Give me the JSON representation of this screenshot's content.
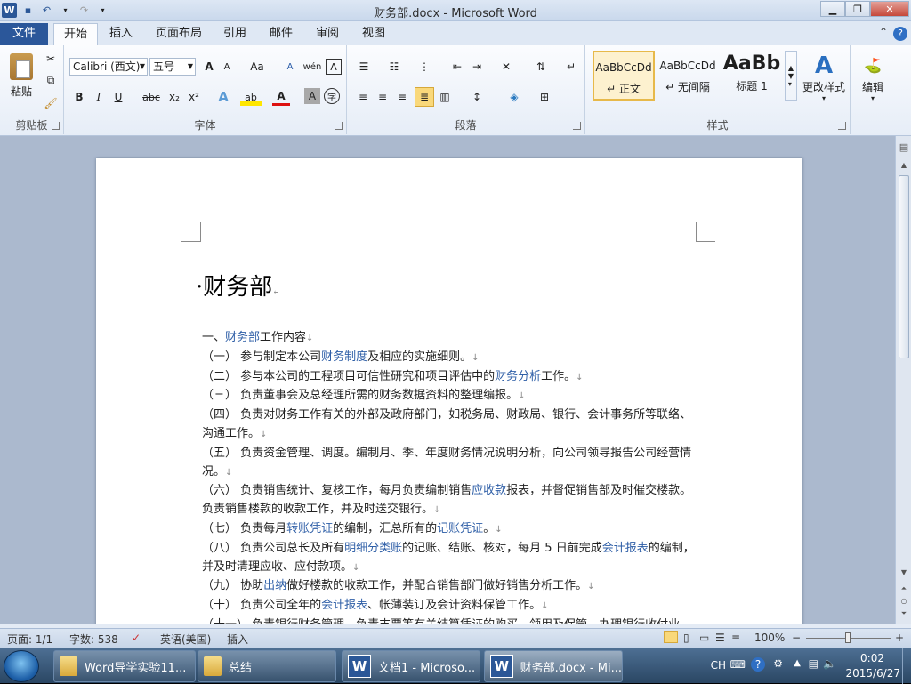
{
  "window": {
    "title": "财务部.docx - Microsoft Word",
    "min": "▁",
    "max": "❐",
    "close": "✕"
  },
  "qat": {
    "logo": "W",
    "save": "💾",
    "undo": "↶",
    "redo": "↷",
    "more": "▾"
  },
  "tabs": [
    {
      "label": "文件"
    },
    {
      "label": "开始"
    },
    {
      "label": "插入"
    },
    {
      "label": "页面布局"
    },
    {
      "label": "引用"
    },
    {
      "label": "邮件"
    },
    {
      "label": "审阅"
    },
    {
      "label": "视图"
    }
  ],
  "ribbon": {
    "clipboard": {
      "label": "剪贴板",
      "paste": "粘贴"
    },
    "font": {
      "label": "字体",
      "name": "Calibri (西文)",
      "size": "五号",
      "grow": "A",
      "shrink": "A",
      "case": "Aa",
      "bold": "B",
      "italic": "I",
      "underline": "U",
      "strike": "abc",
      "sub": "x₂",
      "sup": "x²",
      "effects": "A",
      "highlight": "ab",
      "color": "A",
      "shading": "A",
      "circle": "字",
      "clear": "A",
      "wen": "文",
      "phon": "wén",
      "border": "A"
    },
    "paragraph": {
      "label": "段落"
    },
    "styles": {
      "label": "样式",
      "items": [
        {
          "preview": "AaBbCcDd",
          "name": "↵ 正文"
        },
        {
          "preview": "AaBbCcDd",
          "name": "↵ 无间隔"
        },
        {
          "preview": "AaBb",
          "name": "标题 1"
        }
      ],
      "change": "更改样式"
    },
    "edit": {
      "label": "编辑"
    }
  },
  "document": {
    "title": "财务部",
    "paragraphs": [
      [
        {
          "t": "一、"
        },
        {
          "t": "财务部",
          "l": 1
        },
        {
          "t": "工作内容"
        }
      ],
      [
        {
          "t": "（一）  参与制定本公司"
        },
        {
          "t": "财务制度",
          "l": 1
        },
        {
          "t": "及相应的实施细则。"
        }
      ],
      [
        {
          "t": "（二）  参与本公司的工程项目可信性研究和项目评估中的"
        },
        {
          "t": "财务分析",
          "l": 1
        },
        {
          "t": "工作。"
        }
      ],
      [
        {
          "t": "（三）  负责董事会及总经理所需的财务数据资料的整理编报。"
        }
      ],
      [
        {
          "t": "（四）  负责对财务工作有关的外部及政府部门，如税务局、财政局、银行、会计事务所等联络、沟通工作。"
        }
      ],
      [
        {
          "t": "（五）  负责资金管理、调度。编制月、季、年度财务情况说明分析，向公司领导报告公司经营情况。"
        }
      ],
      [
        {
          "t": "（六）  负责销售统计、复核工作，每月负责编制销售"
        },
        {
          "t": "应收款",
          "l": 1
        },
        {
          "t": "报表，并督促销售部及时催交楼款。负责销售楼款的收款工作，并及时送交银行。"
        }
      ],
      [
        {
          "t": "（七）  负责每月"
        },
        {
          "t": "转账凭证",
          "l": 1
        },
        {
          "t": "的编制，汇总所有的"
        },
        {
          "t": "记账凭证",
          "l": 1
        },
        {
          "t": "。"
        }
      ],
      [
        {
          "t": "（八）  负责公司总长及所有"
        },
        {
          "t": "明细分类账",
          "l": 1
        },
        {
          "t": "的记账、结账、核对，每月 5 日前完成"
        },
        {
          "t": "会计报表",
          "l": 1
        },
        {
          "t": "的编制，并及时清理应收、应付款项。"
        }
      ],
      [
        {
          "t": "（九）  协助"
        },
        {
          "t": "出纳",
          "l": 1
        },
        {
          "t": "做好楼款的收款工作，并配合销售部门做好销售分析工作。"
        }
      ],
      [
        {
          "t": "（十）  负责公司全年的"
        },
        {
          "t": "会计报表",
          "l": 1
        },
        {
          "t": "、帐薄装订及会计资料保管工作。"
        }
      ],
      [
        {
          "t": "（十一）  负责银行财务管理，负责支票等有关结算凭证的购买、领用及保管，办理银行收付业务。"
        }
      ]
    ]
  },
  "status": {
    "page": "页面: 1/1",
    "words": "字数: 538",
    "lang": "英语(美国)",
    "mode": "插入",
    "zoom": "100%",
    "minus": "−",
    "plus": "+"
  },
  "taskbar": {
    "items": [
      {
        "label": "Word导学实验11..."
      },
      {
        "label": "总结"
      },
      {
        "label": "文档1 - Microso..."
      },
      {
        "label": "财务部.docx - Mi..."
      }
    ],
    "ime": "CH",
    "time": "0:02",
    "date": "2015/6/27"
  }
}
